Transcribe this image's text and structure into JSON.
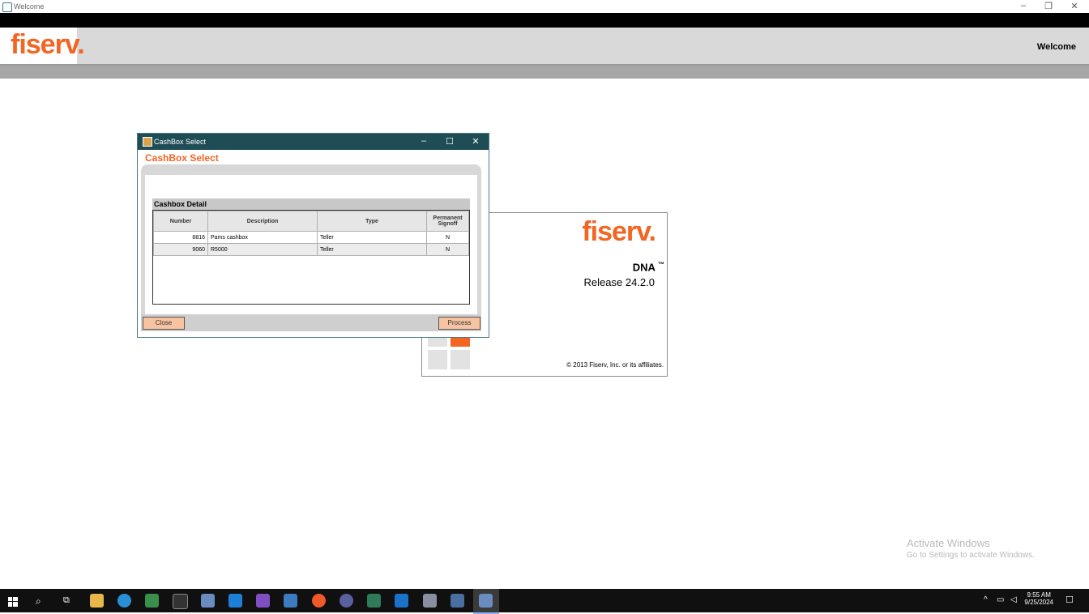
{
  "window": {
    "title": "Welcome"
  },
  "header": {
    "logo": "fiserv.",
    "welcome": "Welcome"
  },
  "splash": {
    "logo": "fiserv.",
    "product": "DNA",
    "tm": "™",
    "release": "Release 24.2.0",
    "copyright": "© 2013 Fiserv, Inc. or its affiliates."
  },
  "dialog": {
    "title": "CashBox Select",
    "heading": "CashBox Select",
    "section": "Cashbox Detail",
    "columns": [
      "Number",
      "Description",
      "Type",
      "Permanent Signoff"
    ],
    "rows": [
      {
        "number": "8816",
        "description": "Pams cashbox",
        "type": "Teller",
        "signoff": "N"
      },
      {
        "number": "9060",
        "description": "R5000",
        "type": "Teller",
        "signoff": "N"
      }
    ],
    "close_label": "Close",
    "process_label": "Process"
  },
  "watermark": {
    "line1": "Activate Windows",
    "line2": "Go to Settings to activate Windows."
  },
  "taskbar": {
    "time": "9:55 AM",
    "date": "9/25/2024",
    "icons": [
      "windows-start-icon",
      "search-icon",
      "task-view-icon",
      "file-explorer-icon",
      "edge-icon",
      "app-icon",
      "terminal-icon",
      "app-icon",
      "vscode-icon",
      "visual-studio-icon",
      "app-icon",
      "app-icon",
      "app-icon",
      "app-icon",
      "app-icon",
      "app-icon",
      "app-icon",
      "app-icon"
    ]
  },
  "colors": {
    "brand": "#f26522",
    "dialog_title": "#1e4d55",
    "button": "#f8c3a0"
  }
}
